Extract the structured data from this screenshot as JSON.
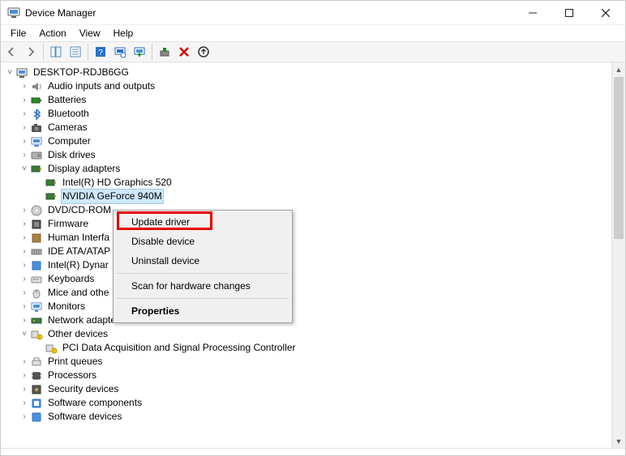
{
  "window": {
    "title": "Device Manager"
  },
  "menus": {
    "file": "File",
    "action": "Action",
    "view": "View",
    "help": "Help"
  },
  "toolbar": {
    "back": "Back",
    "forward": "Forward",
    "show_hide": "Show/Hide",
    "properties": "Properties",
    "help": "Help",
    "scan": "Scan for hardware changes",
    "update": "Update driver",
    "enable": "Enable device",
    "uninstall": "Uninstall device",
    "add_legacy": "Add legacy hardware"
  },
  "tree": {
    "root": "DESKTOP-RDJB6GG",
    "audio": "Audio inputs and outputs",
    "batteries": "Batteries",
    "bluetooth": "Bluetooth",
    "cameras": "Cameras",
    "computer": "Computer",
    "disk_drives": "Disk drives",
    "display_adapters": "Display adapters",
    "intel_gfx": "Intel(R) HD Graphics 520",
    "nvidia": "NVIDIA GeForce 940M",
    "dvd": "DVD/CD-ROM",
    "firmware": "Firmware",
    "hid": "Human Interfa",
    "ide": "IDE ATA/ATAP",
    "intel_dyn": "Intel(R) Dynar",
    "keyboards": "Keyboards",
    "mice": "Mice and othe",
    "monitors": "Monitors",
    "network": "Network adapters",
    "other": "Other devices",
    "pci_dev": "PCI Data Acquisition and Signal Processing Controller",
    "print_queues": "Print queues",
    "processors": "Processors",
    "security": "Security devices",
    "sw_components": "Software components",
    "sw_devices": "Software devices"
  },
  "context": {
    "update": "Update driver",
    "disable": "Disable device",
    "uninstall": "Uninstall device",
    "scan": "Scan for hardware changes",
    "properties": "Properties"
  }
}
